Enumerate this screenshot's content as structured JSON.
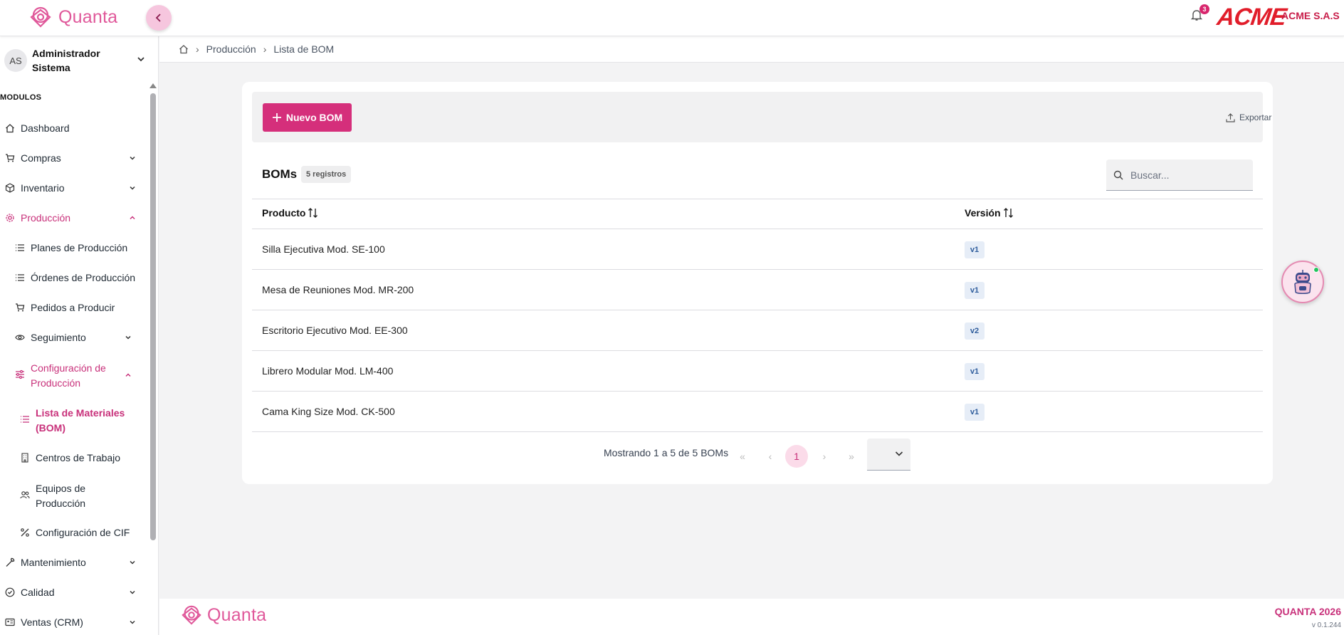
{
  "app": {
    "name": "Quanta",
    "company_logo": "ACME",
    "company_name": "ACME S.A.S",
    "notifications_count": "3",
    "accent_color": "#d52f7b"
  },
  "user": {
    "initials": "AS",
    "name": "Administrador Sistema"
  },
  "sidebar": {
    "section": "MODULOS",
    "items": [
      {
        "label": "Dashboard",
        "icon": "home-icon"
      },
      {
        "label": "Compras",
        "icon": "cart-icon"
      },
      {
        "label": "Inventario",
        "icon": "box-icon"
      },
      {
        "label": "Producción",
        "icon": "gear-icon"
      },
      {
        "label": "Planes de Producción",
        "icon": "list-icon"
      },
      {
        "label": "Órdenes de Producción",
        "icon": "list-icon"
      },
      {
        "label": "Pedidos a Producir",
        "icon": "cart-icon"
      },
      {
        "label": "Seguimiento",
        "icon": "eye-icon"
      },
      {
        "label": "Configuración de Producción",
        "icon": "sliders-icon"
      },
      {
        "label": "Lista de Materiales (BOM)",
        "icon": "list-icon"
      },
      {
        "label": "Centros de Trabajo",
        "icon": "building-icon"
      },
      {
        "label": "Equipos de Producción",
        "icon": "users-icon"
      },
      {
        "label": "Configuración de CIF",
        "icon": "percent-icon"
      },
      {
        "label": "Mantenimiento",
        "icon": "wrench-icon"
      },
      {
        "label": "Calidad",
        "icon": "check-circle-icon"
      },
      {
        "label": "Ventas (CRM)",
        "icon": "id-card-icon"
      }
    ]
  },
  "breadcrumb": {
    "items": [
      "Producción",
      "Lista de BOM"
    ]
  },
  "toolbar": {
    "new_label": "Nuevo BOM",
    "export_label": "Exportar"
  },
  "table": {
    "title": "BOMs",
    "count_label": "5 registros",
    "search_placeholder": "Buscar...",
    "columns": [
      "Producto",
      "Versión"
    ],
    "rows": [
      {
        "product": "Silla Ejecutiva Mod. SE-100",
        "version": "v1"
      },
      {
        "product": "Mesa de Reuniones Mod. MR-200",
        "version": "v1"
      },
      {
        "product": "Escritorio Ejecutivo Mod. EE-300",
        "version": "v2"
      },
      {
        "product": "Librero Modular Mod. LM-400",
        "version": "v1"
      },
      {
        "product": "Cama King Size Mod. CK-500",
        "version": "v1"
      }
    ]
  },
  "pagination": {
    "summary": "Mostrando 1 a 5 de 5 BOMs",
    "current_page": "1",
    "first": "«",
    "prev": "‹",
    "next": "›",
    "last": "»"
  },
  "footer": {
    "brand": "QUANTA 2026",
    "version": "v 0.1.244"
  }
}
